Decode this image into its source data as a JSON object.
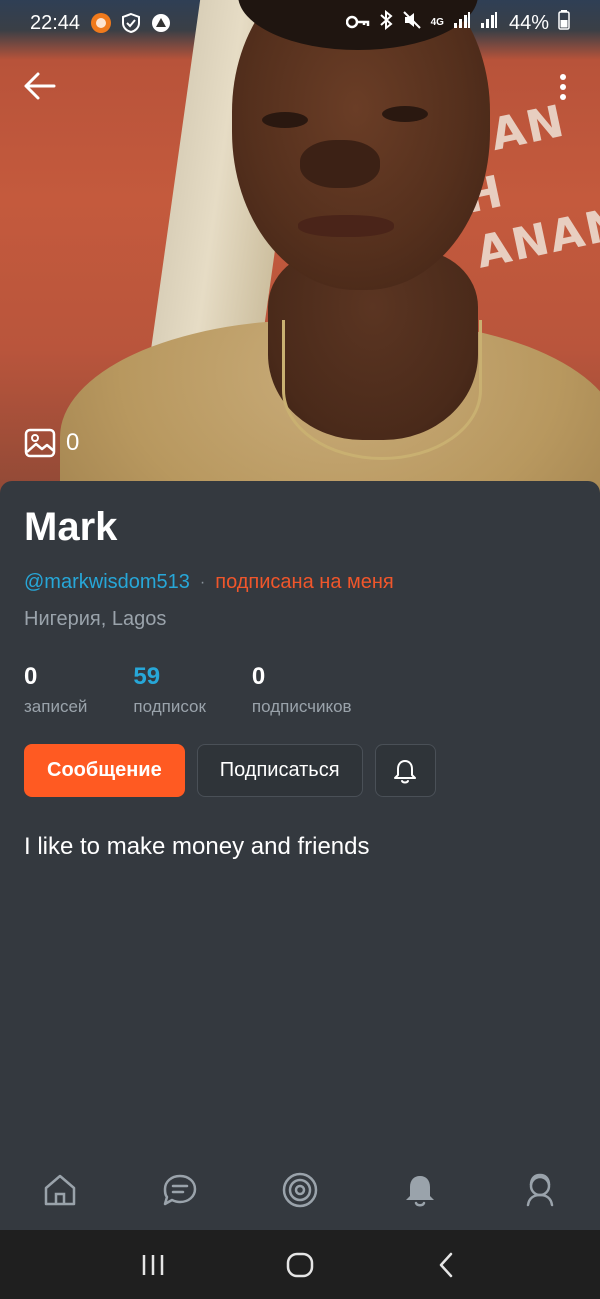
{
  "status_bar": {
    "time": "22:44",
    "network": "4G",
    "battery": "44%"
  },
  "profile": {
    "photo_count": "0",
    "name": "Mark",
    "handle": "@markwisdom513",
    "separator": "·",
    "follows_me": "подписана на меня",
    "location": "Нигерия, Lagos",
    "bio": "I like to make money and friends"
  },
  "stats": [
    {
      "value": "0",
      "label": "записей"
    },
    {
      "value": "59",
      "label": "подписок"
    },
    {
      "value": "0",
      "label": "подписчиков"
    }
  ],
  "actions": {
    "message_label": "Сообщение",
    "subscribe_label": "Подписаться"
  },
  "bottom_nav": [
    "home-icon",
    "chat-icon",
    "target-icon",
    "bell-icon",
    "profile-icon"
  ],
  "colors": {
    "accent": "#ff5a22",
    "link": "#27a7d8",
    "background": "#34393f"
  }
}
